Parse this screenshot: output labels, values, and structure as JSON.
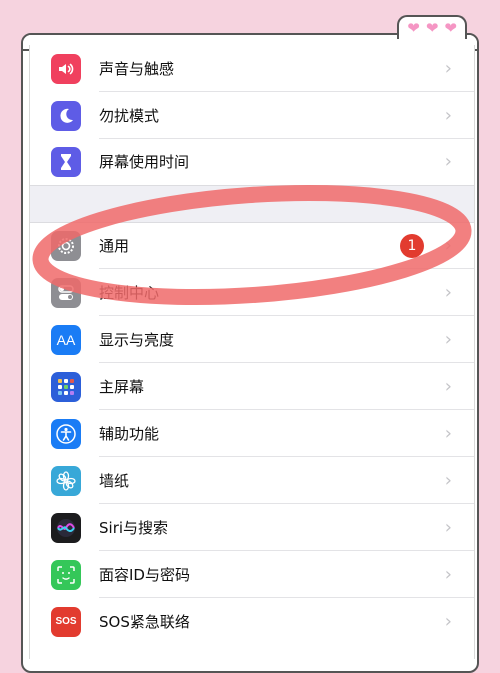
{
  "settings_rows": [
    {
      "label": "声音与触感",
      "icon": "speaker-icon",
      "color": "#f0405e"
    },
    {
      "label": "勿扰模式",
      "icon": "moon-icon",
      "color": "#5e5ce6"
    },
    {
      "label": "屏幕使用时间",
      "icon": "hourglass-icon",
      "color": "#5e5ce6"
    },
    {
      "label": "通用",
      "icon": "gear-icon",
      "color": "#8e8e93",
      "badge": "1"
    },
    {
      "label": "控制中心",
      "icon": "toggles-icon",
      "color": "#8e8e93"
    },
    {
      "label": "显示与亮度",
      "icon": "text-size-icon",
      "color": "#1a7cf5"
    },
    {
      "label": "主屏幕",
      "icon": "home-grid-icon",
      "color": "#2c5fd9"
    },
    {
      "label": "辅助功能",
      "icon": "accessibility-icon",
      "color": "#1a7cf5"
    },
    {
      "label": "墙纸",
      "icon": "flower-icon",
      "color": "#38a8d8"
    },
    {
      "label": "Siri与搜索",
      "icon": "siri-icon",
      "color": "#1c1c1e"
    },
    {
      "label": "面容ID与密码",
      "icon": "face-id-icon",
      "color": "#34c759"
    },
    {
      "label": "SOS紧急联络",
      "icon": "sos-icon",
      "color": "#e23b2f",
      "icon_text": "SOS"
    }
  ],
  "text_icon_label": "AA",
  "annotation_color": "#f06a6a",
  "decor_hearts": [
    "heart-icon",
    "heart-icon",
    "heart-icon"
  ]
}
